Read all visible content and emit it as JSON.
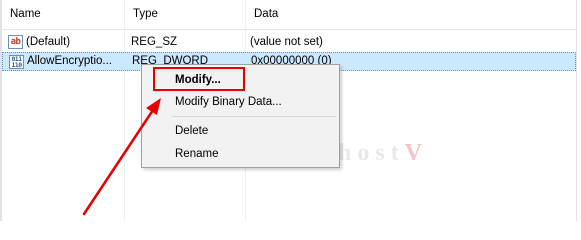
{
  "columns": {
    "name": "Name",
    "type": "Type",
    "data": "Data"
  },
  "rows": [
    {
      "icon": "string-value-icon",
      "icon_text": "ab",
      "name": "(Default)",
      "type": "REG_SZ",
      "data": "(value not set)",
      "selected": false
    },
    {
      "icon": "dword-value-icon",
      "icon_text_top": "011",
      "icon_text_bottom": "110",
      "name": "AllowEncryptio...",
      "type": "REG_DWORD",
      "data": "0x00000000 (0)",
      "selected": true
    }
  ],
  "context_menu": {
    "items": [
      {
        "label": "Modify...",
        "default": true
      },
      {
        "label": "Modify Binary Data..."
      },
      {
        "label": "Delete"
      },
      {
        "label": "Rename"
      }
    ]
  },
  "watermark": {
    "text": "vinahost",
    "mark": "V"
  },
  "colors": {
    "selection": "#cce8ff",
    "annotation": "#e60000",
    "menu_background": "#f2f2f2"
  }
}
